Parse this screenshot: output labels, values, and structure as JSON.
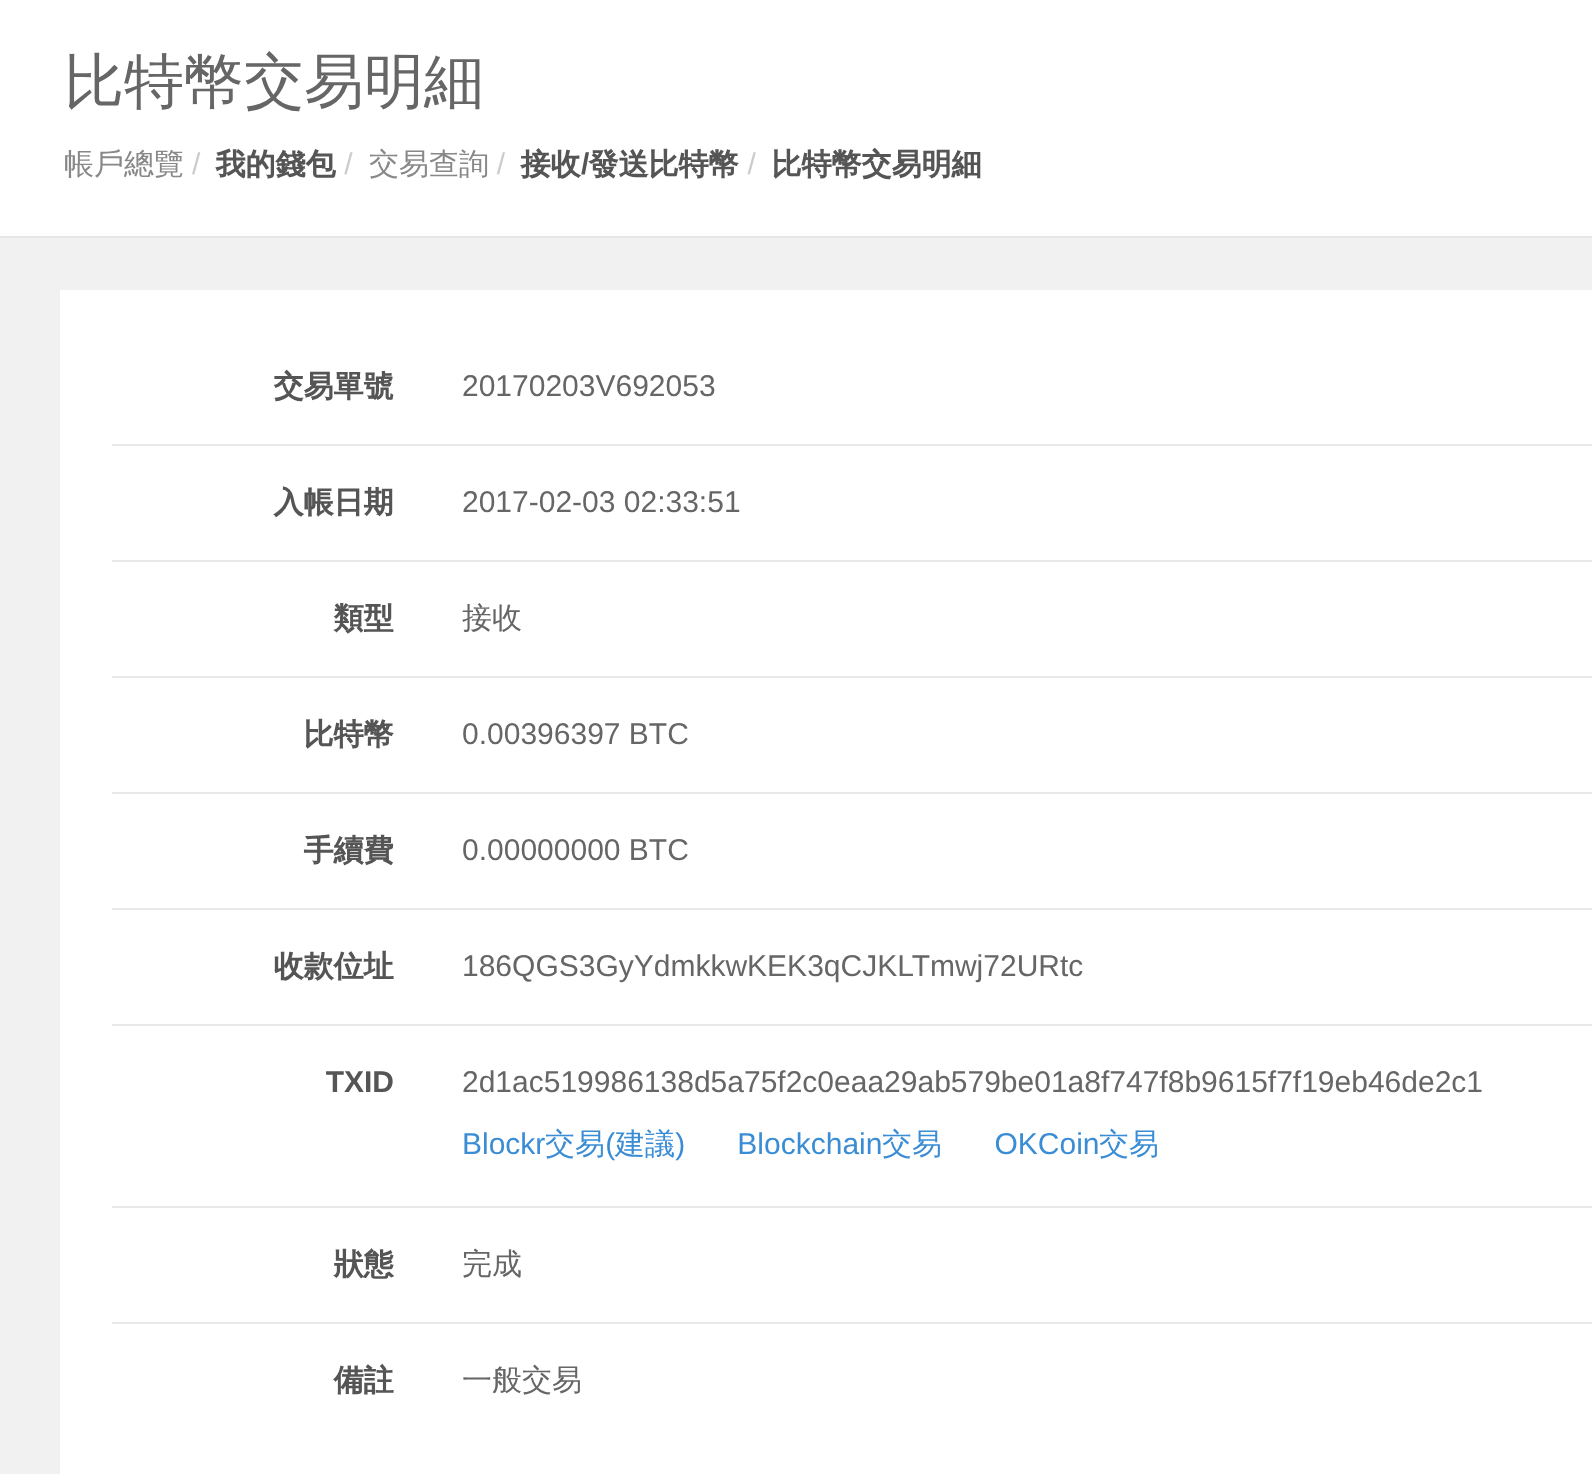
{
  "page_title": "比特幣交易明細",
  "breadcrumb": [
    {
      "label": "帳戶總覽",
      "kind": "plain"
    },
    {
      "label": "我的錢包",
      "kind": "strong"
    },
    {
      "label": "交易查詢",
      "kind": "plain"
    },
    {
      "label": "接收/發送比特幣",
      "kind": "strong"
    },
    {
      "label": "比特幣交易明細",
      "kind": "strong"
    }
  ],
  "breadcrumb_separator": "/",
  "details": [
    {
      "label": "交易單號",
      "value": "20170203V692053"
    },
    {
      "label": "入帳日期",
      "value": "2017-02-03 02:33:51"
    },
    {
      "label": "類型",
      "value": "接收"
    },
    {
      "label": "比特幣",
      "value": "0.00396397 BTC"
    },
    {
      "label": "手續費",
      "value": "0.00000000 BTC"
    },
    {
      "label": "收款位址",
      "value": "186QGS3GyYdmkkwKEK3qCJKLTmwj72URtc"
    },
    {
      "label": "TXID",
      "value": "2d1ac519986138d5a75f2c0eaa29ab579be01a8f747f8b9615f7f19eb46de2c1",
      "links": [
        "Blockr交易(建議)",
        "Blockchain交易",
        "OKCoin交易"
      ]
    },
    {
      "label": "狀態",
      "value": "完成"
    },
    {
      "label": "備註",
      "value": "一般交易"
    }
  ]
}
